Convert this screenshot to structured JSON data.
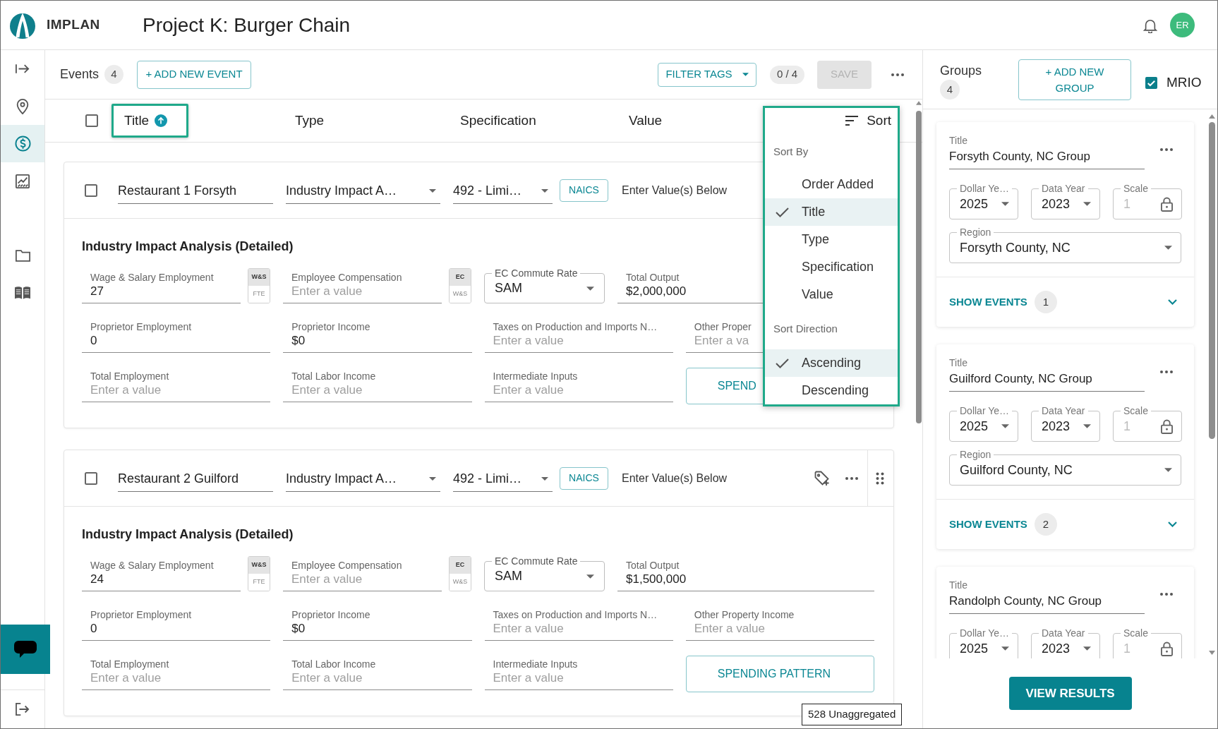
{
  "header": {
    "brand": "IMPLAN",
    "title": "Project K: Burger Chain",
    "user_initials": "ER"
  },
  "sidebar": {
    "sections": [
      {
        "items": [
          {
            "selected": false
          },
          {
            "selected": true
          },
          {
            "selected": false
          }
        ]
      },
      {
        "items": [
          {
            "selected": false
          },
          {
            "selected": false
          }
        ]
      }
    ]
  },
  "events_toolbar": {
    "title": "Events",
    "count": "4",
    "add_button": "+ ADD NEW EVENT",
    "filter_button": "FILTER TAGS",
    "selection_count": "0 / 4",
    "save_button": {
      "label": "SAVE",
      "disabled": true
    }
  },
  "table": {
    "all_checked": false,
    "columns": [
      {
        "label": "Title",
        "sorted": true,
        "highlighted": true
      },
      {
        "label": "Type",
        "sorted": false,
        "highlighted": false
      },
      {
        "label": "Specification",
        "sorted": false,
        "highlighted": false
      },
      {
        "label": "Value",
        "sorted": false,
        "highlighted": false
      }
    ]
  },
  "sort_menu": {
    "label": "Sort",
    "highlighted": true,
    "sections": [
      {
        "heading": "Sort By",
        "options": [
          {
            "label": "Order Added",
            "selected": false
          },
          {
            "label": "Title",
            "selected": true
          },
          {
            "label": "Type",
            "selected": false
          },
          {
            "label": "Specification",
            "selected": false
          },
          {
            "label": "Value",
            "selected": false
          }
        ]
      },
      {
        "heading": "Sort Direction",
        "options": [
          {
            "label": "Ascending",
            "selected": true
          },
          {
            "label": "Descending",
            "selected": false
          }
        ]
      }
    ]
  },
  "events": [
    {
      "checked": false,
      "title": "Restaurant 1 Forsyth",
      "type": "Industry Impact A…",
      "specification": "492 - Limi…",
      "code_button": "NAICS",
      "value_note": "Enter Value(s) Below",
      "actions_shown": false,
      "section_title": "Industry Impact Analysis (Detailed)",
      "field_rows": [
        [
          {
            "kind": "input",
            "label": "Wage & Salary Employment",
            "value": "27",
            "units": [
              {
                "label": "W&S",
                "selected": true
              },
              {
                "label": "FTE",
                "selected": false
              }
            ]
          },
          {
            "kind": "input",
            "label": "Employee Compensation",
            "placeholder": "Enter a value",
            "units": [
              {
                "label": "EC",
                "selected": true
              },
              {
                "label": "W&S",
                "selected": false
              }
            ]
          },
          {
            "kind": "select",
            "label": "EC Commute Rate",
            "value": "SAM"
          },
          {
            "kind": "input",
            "label": "Total Output",
            "value": "$2,000,000"
          }
        ],
        [
          {
            "kind": "input",
            "label": "Proprietor Employment",
            "value": "0"
          },
          {
            "kind": "input",
            "label": "Proprietor Income",
            "value": "$0"
          },
          {
            "kind": "input",
            "label": "Taxes on Production and Imports N…",
            "placeholder": "Enter a value"
          },
          {
            "kind": "input",
            "label": "Other Proper",
            "placeholder": "Enter a va"
          }
        ],
        [
          {
            "kind": "input",
            "label": "Total Employment",
            "placeholder": "Enter a value"
          },
          {
            "kind": "input",
            "label": "Total Labor Income",
            "placeholder": "Enter a value"
          },
          {
            "kind": "input",
            "label": "Intermediate Inputs",
            "placeholder": "Enter a value"
          },
          {
            "kind": "button",
            "label": "SPEND"
          }
        ]
      ]
    },
    {
      "checked": false,
      "title": "Restaurant 2 Guilford",
      "type": "Industry Impact A…",
      "specification": "492 - Limi…",
      "code_button": "NAICS",
      "value_note": "Enter Value(s) Below",
      "actions_shown": true,
      "section_title": "Industry Impact Analysis (Detailed)",
      "field_rows": [
        [
          {
            "kind": "input",
            "label": "Wage & Salary Employment",
            "value": "24",
            "units": [
              {
                "label": "W&S",
                "selected": true
              },
              {
                "label": "FTE",
                "selected": false
              }
            ]
          },
          {
            "kind": "input",
            "label": "Employee Compensation",
            "placeholder": "Enter a value",
            "units": [
              {
                "label": "EC",
                "selected": true
              },
              {
                "label": "W&S",
                "selected": false
              }
            ]
          },
          {
            "kind": "select",
            "label": "EC Commute Rate",
            "value": "SAM"
          },
          {
            "kind": "input",
            "label": "Total Output",
            "value": "$1,500,000"
          }
        ],
        [
          {
            "kind": "input",
            "label": "Proprietor Employment",
            "value": "0"
          },
          {
            "kind": "input",
            "label": "Proprietor Income",
            "value": "$0"
          },
          {
            "kind": "input",
            "label": "Taxes on Production and Imports N…",
            "placeholder": "Enter a value"
          },
          {
            "kind": "input",
            "label": "Other Property Income",
            "placeholder": "Enter a value"
          }
        ],
        [
          {
            "kind": "input",
            "label": "Total Employment",
            "placeholder": "Enter a value"
          },
          {
            "kind": "input",
            "label": "Total Labor Income",
            "placeholder": "Enter a value"
          },
          {
            "kind": "input",
            "label": "Intermediate Inputs",
            "placeholder": "Enter a value"
          },
          {
            "kind": "button",
            "label": "SPENDING PATTERN"
          }
        ]
      ]
    }
  ],
  "tooltip": "528 Unaggregated",
  "groups_panel": {
    "title": "Groups",
    "count": "4",
    "add_button": "+ ADD NEW GROUP",
    "mrio": {
      "label": "MRIO",
      "checked": true
    },
    "groups": [
      {
        "title_label": "Title",
        "title": "Forsyth County, NC Group",
        "dollar_year": {
          "label": "Dollar Ye…",
          "value": "2025"
        },
        "data_year": {
          "label": "Data Year",
          "value": "2023"
        },
        "scale": {
          "label": "Scale",
          "value": "1",
          "locked": true
        },
        "region": {
          "label": "Region",
          "value": "Forsyth County, NC"
        },
        "show_events": {
          "label": "SHOW EVENTS",
          "count": "1",
          "expanded": false
        }
      },
      {
        "title_label": "Title",
        "title": "Guilford County, NC Group",
        "dollar_year": {
          "label": "Dollar Ye…",
          "value": "2025"
        },
        "data_year": {
          "label": "Data Year",
          "value": "2023"
        },
        "scale": {
          "label": "Scale",
          "value": "1",
          "locked": true
        },
        "region": {
          "label": "Region",
          "value": "Guilford County, NC"
        },
        "show_events": {
          "label": "SHOW EVENTS",
          "count": "2",
          "expanded": false
        }
      },
      {
        "title_label": "Title",
        "title": "Randolph County, NC Group",
        "dollar_year": {
          "label": "Dollar Ye…",
          "value": "2025"
        },
        "data_year": {
          "label": "Data Year",
          "value": "2023"
        },
        "scale": {
          "label": "Scale",
          "value": "1",
          "locked": true
        }
      }
    ],
    "view_results": "VIEW RESULTS"
  }
}
